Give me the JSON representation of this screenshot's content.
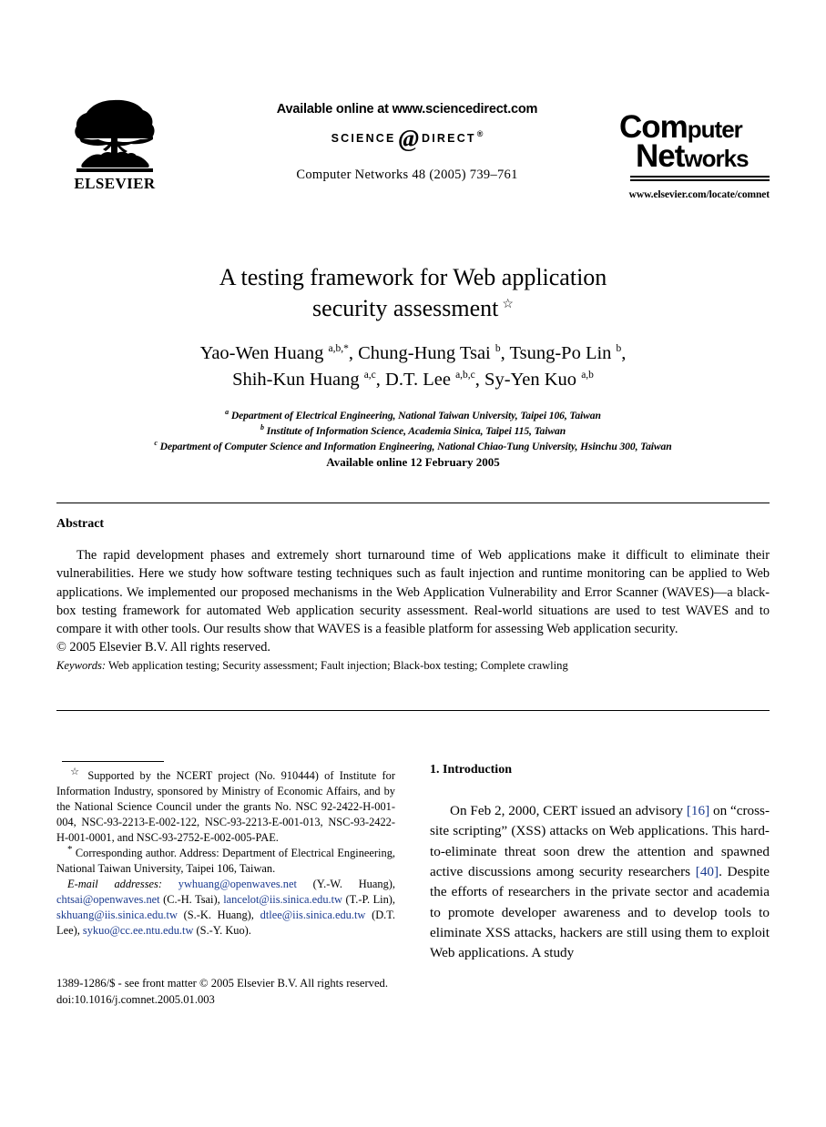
{
  "masthead": {
    "publisher_logo_alt": "elsevier-tree-logo",
    "publisher_name": "ELSEVIER",
    "available_online": "Available online at www.sciencedirect.com",
    "sciencedirect_left": "SCIENCE",
    "sciencedirect_at": "@",
    "sciencedirect_right": "DIRECT",
    "sciencedirect_reg": "®",
    "journal_reference": "Computer Networks 48 (2005) 739–761",
    "journal_logo_line1_big": "C",
    "journal_logo_line1": "Computer",
    "journal_logo_line2": "Networks",
    "journal_url": "www.elsevier.com/locate/comnet"
  },
  "article": {
    "title_line1": "A testing framework for Web application",
    "title_line2": "security assessment",
    "title_footnote_mark": "☆",
    "authors_line1": "Yao-Wen Huang a,b,*, Chung-Hung Tsai b, Tsung-Po Lin b,",
    "authors_line2": "Shih-Kun Huang a,c, D.T. Lee a,b,c, Sy-Yen Kuo a,b",
    "affiliation_a": "Department of Electrical Engineering, National Taiwan University, Taipei 106, Taiwan",
    "affiliation_b": "Institute of Information Science, Academia Sinica, Taipei 115, Taiwan",
    "affiliation_c": "Department of Computer Science and Information Engineering, National Chiao-Tung University, Hsinchu 300, Taiwan",
    "available_online_date": "Available online 12 February 2005"
  },
  "abstract": {
    "heading": "Abstract",
    "paragraph": "The rapid development phases and extremely short turnaround time of Web applications make it difficult to eliminate their vulnerabilities. Here we study how software testing techniques such as fault injection and runtime monitoring can be applied to Web applications. We implemented our proposed mechanisms in the Web Application Vulnerability and Error Scanner (WAVES)—a black-box testing framework for automated Web application security assessment. Real-world situations are used to test WAVES and to compare it with other tools. Our results show that WAVES is a feasible platform for assessing Web application security.",
    "copyright": "© 2005 Elsevier B.V. All rights reserved.",
    "keywords_label": "Keywords:",
    "keywords_value": "Web application testing; Security assessment; Fault injection; Black-box testing; Complete crawling"
  },
  "footnotes": {
    "funding_mark": "☆",
    "funding_text": "Supported by the NCERT project (No. 910444) of Institute for Information Industry, sponsored by Ministry of Economic Affairs, and by the National Science Council under the grants No. NSC 92-2422-H-001-004, NSC-93-2213-E-002-122, NSC-93-2213-E-001-013, NSC-93-2422-H-001-0001, and NSC-93-2752-E-002-005-PAE.",
    "corresponding_mark": "*",
    "corresponding_text": "Corresponding author. Address: Department of Electrical Engineering, National Taiwan University, Taipei 106, Taiwan.",
    "email_label": "E-mail addresses:",
    "emails": [
      {
        "address": "ywhuang@openwaves.net",
        "person": "(Y.-W. Huang),"
      },
      {
        "address": "chtsai@openwaves.net",
        "person": "(C.-H. Tsai),"
      },
      {
        "address": "lancelot@iis.sinica.edu.tw",
        "person": "(T.-P. Lin),"
      },
      {
        "address": "skhuang@iis.sinica.edu.tw",
        "person": "(S.-K. Huang),"
      },
      {
        "address": "dtlee@iis.sinica.edu.tw",
        "person": "(D.T. Lee),"
      },
      {
        "address": "sykuo@cc.ee.ntu.edu.tw",
        "person": "(S.-Y. Kuo)."
      }
    ]
  },
  "footer": {
    "issn_line": "1389-1286/$ - see front matter © 2005 Elsevier B.V. All rights reserved.",
    "doi_line": "doi:10.1016/j.comnet.2005.01.003"
  },
  "introduction": {
    "heading": "1. Introduction",
    "text_part1": "On Feb 2, 2000, CERT issued an advisory ",
    "citation1": "[16]",
    "text_part2": " on “cross-site scripting” (XSS) attacks on Web applications. This hard-to-eliminate threat soon drew the attention and spawned active discussions among security researchers ",
    "citation2": "[40]",
    "text_part3": ". Despite the efforts of researchers in the private sector and academia to promote developer awareness and to develop tools to eliminate XSS attacks, hackers are still using them to exploit Web applications. A study"
  },
  "colors": {
    "link": "#1a3a8f",
    "text": "#000000",
    "background": "#ffffff"
  }
}
